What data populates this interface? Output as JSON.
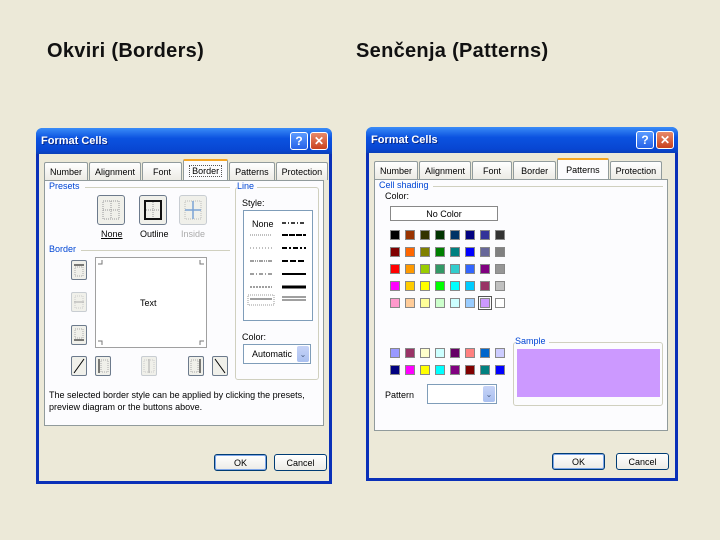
{
  "headings": {
    "left": "Okviri (Borders)",
    "right": "Senčenja (Patterns)"
  },
  "dialog": {
    "title": "Format Cells",
    "help_icon": "?",
    "close_icon": "✕",
    "tabs": [
      "Number",
      "Alignment",
      "Font",
      "Border",
      "Patterns",
      "Protection"
    ],
    "ok_label": "OK",
    "cancel_label": "Cancel"
  },
  "borders_dialog": {
    "active_tab": "Border",
    "presets_label": "Presets",
    "presets": [
      {
        "label": "None",
        "icon": "preset-none-icon",
        "enabled": true
      },
      {
        "label": "Outline",
        "icon": "preset-outline-icon",
        "enabled": true
      },
      {
        "label": "Inside",
        "icon": "preset-inside-icon",
        "enabled": false
      }
    ],
    "border_label": "Border",
    "preview_text": "Text",
    "line_label": "Line",
    "style_label": "Style:",
    "style_none": "None",
    "color_label": "Color:",
    "color_value": "Automatic",
    "info_text": "The selected border style can be applied by clicking the presets, preview diagram or the buttons above."
  },
  "patterns_dialog": {
    "active_tab": "Patterns",
    "cell_shading_label": "Cell shading",
    "color_label": "Color:",
    "no_color_label": "No Color",
    "palette": [
      [
        "#000000",
        "#993300",
        "#333300",
        "#003300",
        "#003366",
        "#000080",
        "#333399",
        "#333333"
      ],
      [
        "#800000",
        "#ff6600",
        "#808000",
        "#008000",
        "#008080",
        "#0000ff",
        "#666699",
        "#808080"
      ],
      [
        "#ff0000",
        "#ff9900",
        "#99cc00",
        "#339966",
        "#33cccc",
        "#3366ff",
        "#800080",
        "#969696"
      ],
      [
        "#ff00ff",
        "#ffcc00",
        "#ffff00",
        "#00ff00",
        "#00ffff",
        "#00ccff",
        "#993366",
        "#c0c0c0"
      ],
      [
        "#ff99cc",
        "#ffcc99",
        "#ffff99",
        "#ccffcc",
        "#ccffff",
        "#99ccff",
        "#cc99ff",
        "#ffffff"
      ]
    ],
    "chart_palette": [
      [
        "#9999ff",
        "#993366",
        "#ffffcc",
        "#ccffff",
        "#660066",
        "#ff8080",
        "#0066cc",
        "#ccccff"
      ],
      [
        "#000080",
        "#ff00ff",
        "#ffff00",
        "#00ffff",
        "#800080",
        "#800000",
        "#008080",
        "#0000ff"
      ]
    ],
    "selected_color": "#cc99ff",
    "sample_label": "Sample",
    "pattern_label": "Pattern",
    "pattern_value": ""
  }
}
